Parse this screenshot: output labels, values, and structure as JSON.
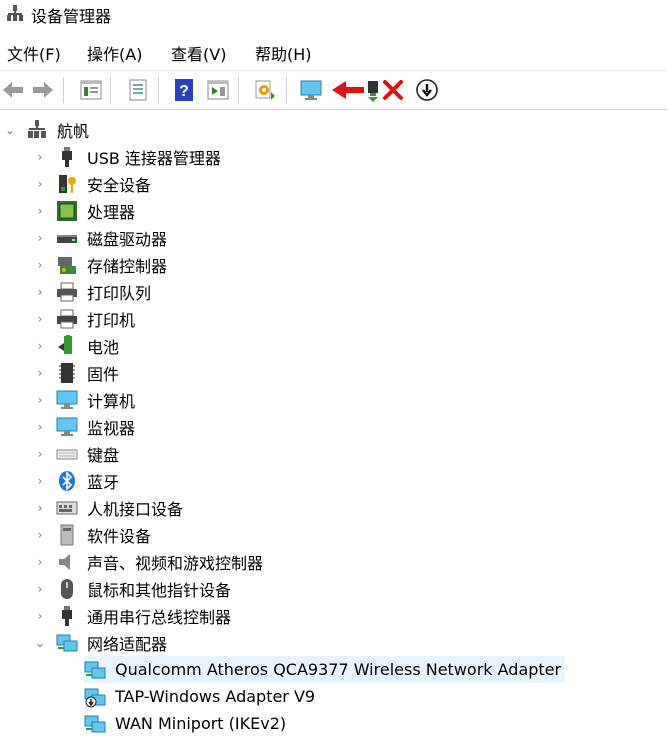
{
  "window": {
    "title": "设备管理器"
  },
  "menu": [
    "文件(F)",
    "操作(A)",
    "查看(V)",
    "帮助(H)"
  ],
  "toolbar": {
    "buttons": [
      "back",
      "forward",
      "properties-view",
      "properties",
      "help",
      "action-view",
      "scan-hardware",
      "monitor",
      "update-driver",
      "uninstall",
      "disable"
    ]
  },
  "tree": {
    "root": "航帆",
    "categories": [
      "USB 连接器管理器",
      "安全设备",
      "处理器",
      "磁盘驱动器",
      "存储控制器",
      "打印队列",
      "打印机",
      "电池",
      "固件",
      "计算机",
      "监视器",
      "键盘",
      "蓝牙",
      "人机接口设备",
      "软件设备",
      "声音、视频和游戏控制器",
      "鼠标和其他指针设备",
      "通用串行总线控制器",
      "网络适配器"
    ],
    "network_adapters": [
      "Qualcomm Atheros QCA9377 Wireless Network Adapter",
      "TAP-Windows Adapter V9",
      "WAN Miniport (IKEv2)"
    ]
  },
  "colors": {
    "accent": "#1e90d6",
    "annotation_arrow": "#e01010",
    "selection": "#e8f3fb"
  }
}
